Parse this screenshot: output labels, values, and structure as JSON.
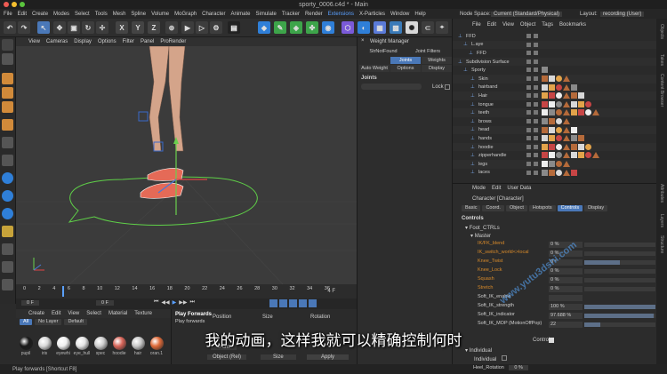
{
  "window": {
    "title": "sporty_0006.c4d * - Main"
  },
  "menubar": {
    "items": [
      "File",
      "Edit",
      "Create",
      "Modes",
      "Select",
      "Tools",
      "Mesh",
      "Spline",
      "Volume",
      "MoGraph",
      "Character",
      "Animate",
      "Simulate",
      "Tracker",
      "Render",
      "Extensions",
      "X-Particles",
      "Window",
      "Help"
    ],
    "node_space_label": "Node Space:",
    "node_space_value": "Current (Standard/Physical)",
    "layout_label": "Layout:",
    "layout_value": "recording (User)"
  },
  "toolbar": {
    "x": "X",
    "y": "Y",
    "z": "Z"
  },
  "viewport": {
    "menu": [
      "View",
      "Cameras",
      "Display",
      "Options",
      "Filter",
      "Panel",
      "ProRender"
    ]
  },
  "timeline": {
    "ticks": [
      "0",
      "2",
      "4",
      "6",
      "8",
      "10",
      "12",
      "14",
      "16",
      "18",
      "20",
      "22",
      "24",
      "26",
      "28",
      "30",
      "32",
      "34",
      "36"
    ],
    "current_frame": "4 F",
    "start": "0 F",
    "end": "0 F"
  },
  "materials": {
    "menu": [
      "Create",
      "Edit",
      "View",
      "Select",
      "Material",
      "Texture"
    ],
    "filters": [
      "All",
      "No Layer",
      "Default"
    ],
    "items": [
      {
        "name": "pupil",
        "color": "#1a1a1a"
      },
      {
        "name": "iris",
        "color": "#d9d9d9"
      },
      {
        "name": "eyewhi",
        "color": "#f0f0f0"
      },
      {
        "name": "eye_hull",
        "color": "#e6e6e6"
      },
      {
        "name": "spec",
        "color": "#cfcfcf"
      },
      {
        "name": "hoodie",
        "color": "#d9665a"
      },
      {
        "name": "hair",
        "color": "#c9c9c9"
      },
      {
        "name": "oran.1",
        "color": "#e06b3a"
      }
    ]
  },
  "coords": {
    "tooltip_title": "Play Forwards",
    "tooltip_desc": "Play forwards",
    "position": "Position",
    "size": "Size",
    "rotation": "Rotation",
    "val1": "0 cm",
    "obj_mode": "Object (Rel)",
    "size_mode": "Size",
    "apply": "Apply"
  },
  "status": {
    "text": "Play forwards [Shortcut F8]"
  },
  "weight": {
    "title": "Weight Manager",
    "tabs": [
      "StrNotFound",
      "Joint Filters"
    ],
    "tabs2": [
      "Auto Weight",
      "Options",
      "Display"
    ],
    "tab_joints": "Joints",
    "tab_weights": "Weights",
    "joints_label": "Joints",
    "lock": "Lock"
  },
  "objects": {
    "menu": [
      "File",
      "Edit",
      "View",
      "Object",
      "Tags",
      "Bookmarks"
    ],
    "items": [
      {
        "name": "FFD",
        "indent": 6
      },
      {
        "name": "L.aye",
        "indent": 12
      },
      {
        "name": "FFD",
        "indent": 18
      },
      {
        "name": "Subdivision Surface",
        "indent": 6
      },
      {
        "name": "Sporty",
        "indent": 12
      },
      {
        "name": "Skin",
        "indent": 20
      },
      {
        "name": "hairband",
        "indent": 20
      },
      {
        "name": "Hair",
        "indent": 20
      },
      {
        "name": "tongue",
        "indent": 20
      },
      {
        "name": "teeth",
        "indent": 20
      },
      {
        "name": "brows",
        "indent": 20
      },
      {
        "name": "head",
        "indent": 20
      },
      {
        "name": "hands",
        "indent": 20
      },
      {
        "name": "hoodie",
        "indent": 20
      },
      {
        "name": "zipperhandle",
        "indent": 20
      },
      {
        "name": "legs",
        "indent": 20
      },
      {
        "name": "laces",
        "indent": 20
      }
    ]
  },
  "attributes": {
    "menu": [
      "Mode",
      "Edit",
      "User Data"
    ],
    "object": "Character [Character]",
    "tabs": [
      "Basic",
      "Coord.",
      "Object",
      "Hotspots",
      "Controls",
      "Display"
    ],
    "active_tab": "Controls",
    "section": "Controls",
    "group": "Foot_CTRLs",
    "subgroup": "Master",
    "params": [
      {
        "label": "IK/FK_blend",
        "value": "0 %",
        "fill": 0
      },
      {
        "label": "IK_switch_world<>local",
        "value": "0 %",
        "fill": 0
      },
      {
        "label": "Knee_Twist",
        "value": "0 °",
        "fill": 0.5
      },
      {
        "label": "Knee_Lock",
        "value": "0 %",
        "fill": 0
      },
      {
        "label": "Squash",
        "value": "0 %",
        "fill": 0
      },
      {
        "label": "Stretch",
        "value": "0 %",
        "fill": 0
      },
      {
        "label": "Soft_IK_enable",
        "value": "",
        "fill": 0
      },
      {
        "label": "Soft_IK_strength",
        "value": "100 %",
        "fill": 1
      },
      {
        "label": "Soft_IK_indicator",
        "value": "97.688 %",
        "fill": 0.98
      },
      {
        "label": "Soft_IK_MOP (MotionOffPop)",
        "value": "22",
        "fill": 0.22
      }
    ],
    "controls_label": "Controls",
    "individual_group": "Individual",
    "individual": "Individual",
    "heel_rotation": "Heel_Rotation",
    "heel_value": "0 %"
  },
  "right_tabs": [
    "Objects",
    "Takes",
    "Content Browser",
    "Attributes",
    "Layers",
    "Structure"
  ],
  "subtitle": "我的动画，这样我就可以精确控制何时",
  "watermark": "www.yutu3dshi.com"
}
